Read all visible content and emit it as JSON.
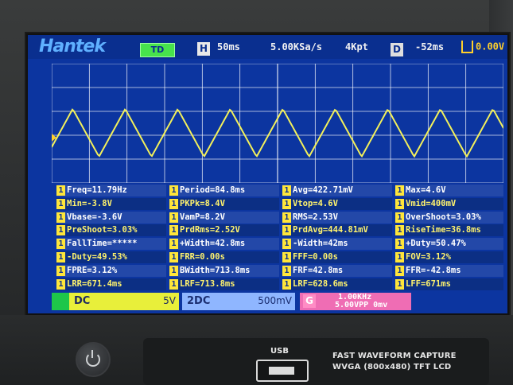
{
  "header": {
    "logo": "Hantek",
    "mode": "TD",
    "timebase_tag": "H",
    "timebase": "50ms",
    "sample_rate": "5.00KSa/s",
    "memory_depth": "4Kpt",
    "delay_tag": "D",
    "delay": "-52ms",
    "trigger_level": "0.00V"
  },
  "measurements": {
    "col1": [
      "Freq=11.79Hz",
      "Min=-3.8V",
      "Vbase=-3.6V",
      "PreShoot=3.03%",
      "FallTime=*****",
      "-Duty=49.53%",
      "FPRE=3.12%",
      "LRR=671.4ms"
    ],
    "col2": [
      "Period=84.8ms",
      "PKPk=8.4V",
      "VamP=8.2V",
      "PrdRms=2.52V",
      "+Width=42.8ms",
      "FRR=0.00s",
      "BWidth=713.8ms",
      "LRF=713.8ms"
    ],
    "col3": [
      "Avg=422.71mV",
      "Vtop=4.6V",
      "RMS=2.53V",
      "PrdAvg=444.81mV",
      "-Width=42ms",
      "FFF=0.00s",
      "FRF=42.8ms",
      "LRF=628.6ms"
    ],
    "col4": [
      "Max=4.6V",
      "Vmid=400mV",
      "OverShoot=3.03%",
      "RiseTime=36.8ms",
      "+Duty=50.47%",
      "FOV=3.12%",
      "FFR=-42.8ms",
      "LFF=671ms"
    ],
    "source_marker": "1"
  },
  "footer": {
    "ch1_coupling": "DC",
    "ch1_scale": "5V",
    "ch2_label": "2DC",
    "ch2_scale": "500mV",
    "gen_tag": "G",
    "gen_freq": "1.00KHz",
    "gen_amp": "5.00VPP 0mv"
  },
  "panel": {
    "usb_label": "USB",
    "line1": "FAST WAVEFORM CAPTURE",
    "line2": "WVGA (800x480) TFT LCD"
  },
  "colors": {
    "screen_bg": "#0c35a0",
    "ch1_trace": "#f4f15a",
    "grid": "#ffffff",
    "ch1_tag": "#e8ef3a",
    "ch2_tag": "#8fb6ff",
    "gen_tag": "#ef6db4"
  },
  "waveform": {
    "type": "triangle",
    "cycles_visible": 8.6,
    "low_div": -0.8,
    "high_div": 1.2
  }
}
